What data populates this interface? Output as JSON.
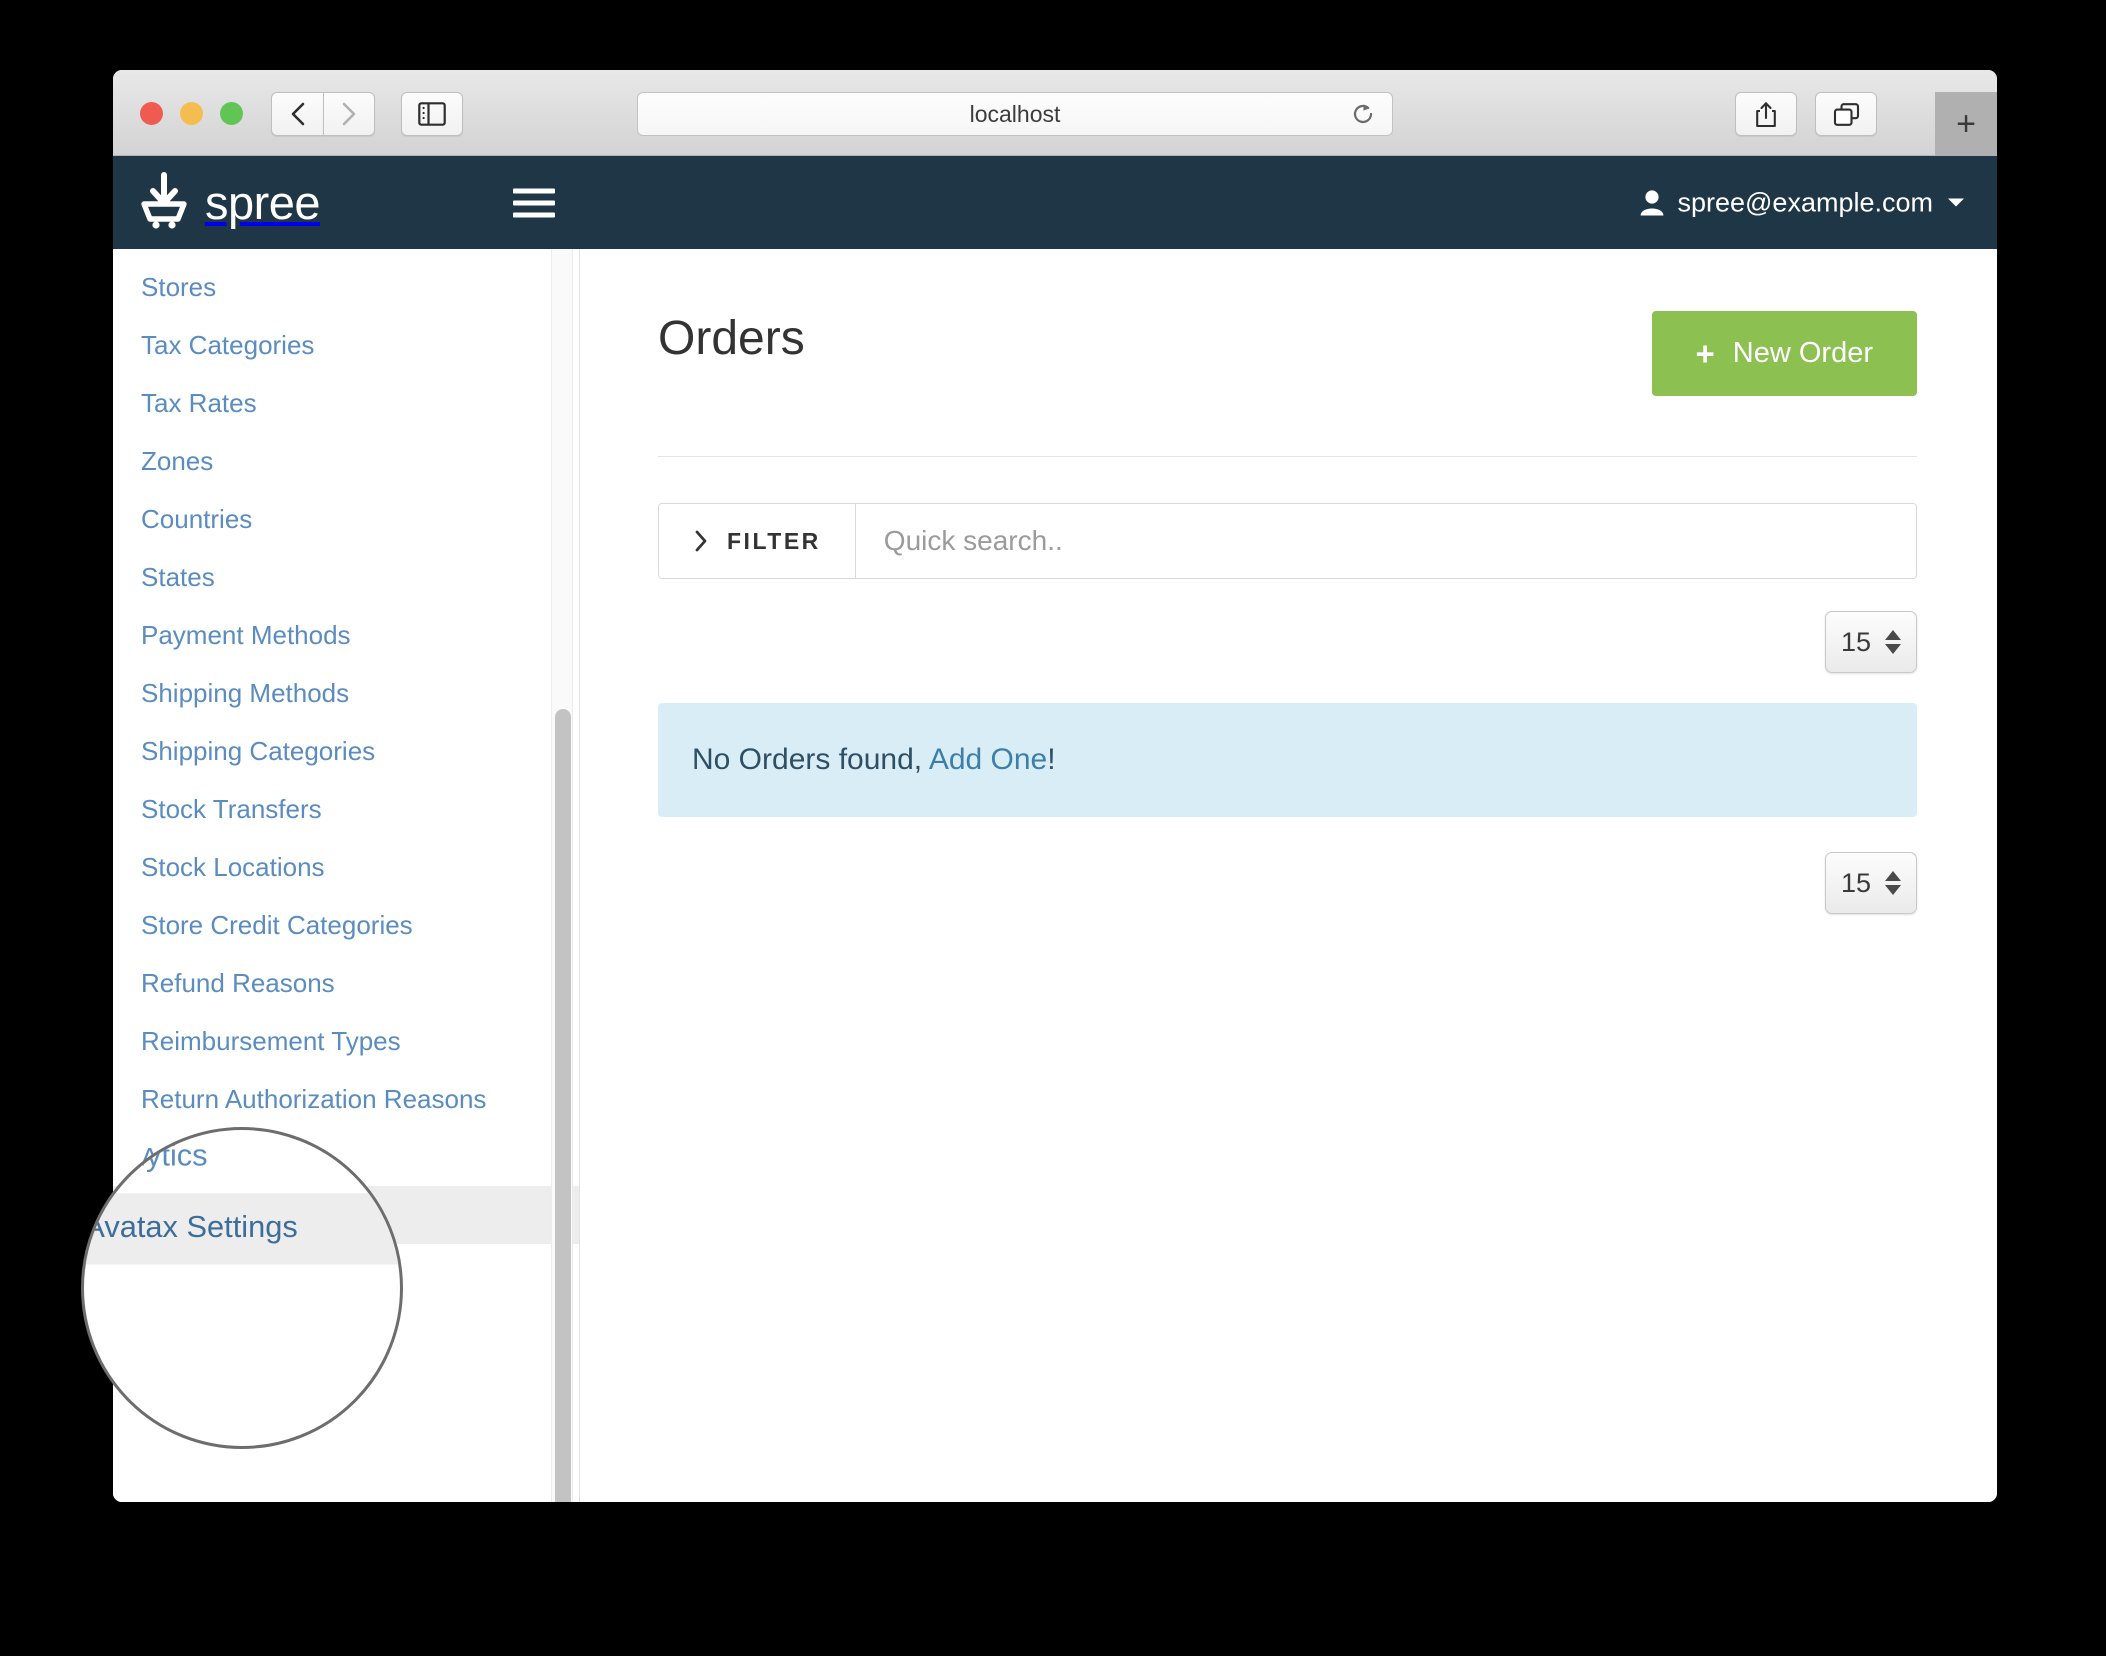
{
  "browser": {
    "url": "localhost",
    "traffic_lights": [
      "close",
      "minimize",
      "zoom"
    ],
    "icons": {
      "back": "back-chevron-icon",
      "forward": "forward-chevron-icon",
      "sidebar": "sidebar-toggle-icon",
      "reload": "reload-icon",
      "share": "share-icon",
      "tabs": "tab-overview-icon",
      "new_tab": "+"
    }
  },
  "header": {
    "brand": "spree",
    "user_email": "spree@example.com",
    "menu_icon": "hamburger-menu-icon",
    "user_icon": "user-avatar-icon",
    "caret_icon": "chevron-down-icon"
  },
  "sidebar": {
    "items": [
      {
        "label": "Stores",
        "active": false
      },
      {
        "label": "Tax Categories",
        "active": false
      },
      {
        "label": "Tax Rates",
        "active": false
      },
      {
        "label": "Zones",
        "active": false
      },
      {
        "label": "Countries",
        "active": false
      },
      {
        "label": "States",
        "active": false
      },
      {
        "label": "Payment Methods",
        "active": false
      },
      {
        "label": "Shipping Methods",
        "active": false
      },
      {
        "label": "Shipping Categories",
        "active": false
      },
      {
        "label": "Stock Transfers",
        "active": false
      },
      {
        "label": "Stock Locations",
        "active": false
      },
      {
        "label": "Store Credit Categories",
        "active": false
      },
      {
        "label": "Refund Reasons",
        "active": false
      },
      {
        "label": "Reimbursement Types",
        "active": false
      },
      {
        "label": "Return Authorization Reasons",
        "active": false
      },
      {
        "label": "Analytics",
        "active": false
      },
      {
        "label": "Avatax Settings",
        "active": true
      }
    ]
  },
  "main": {
    "title": "Orders",
    "new_order_label": "New Order",
    "new_order_plus": "+",
    "filter_label": "FILTER",
    "filter_icon": "chevron-right-icon",
    "search_placeholder": "Quick search..",
    "search_value": "",
    "per_page_value": "15",
    "empty_message_prefix": "No Orders found,",
    "empty_message_link": "Add One",
    "empty_message_suffix": "!"
  },
  "magnifier": {
    "items": [
      {
        "label": "Analytics",
        "active": false
      },
      {
        "label": "Avatax Settings",
        "active": true
      }
    ]
  },
  "colors": {
    "brand_navy": "#1f3646",
    "accent_green": "#8cc152",
    "link_blue": "#5b8cc0",
    "alert_blue_bg": "#d9edf7",
    "active_row": "#ededed"
  }
}
